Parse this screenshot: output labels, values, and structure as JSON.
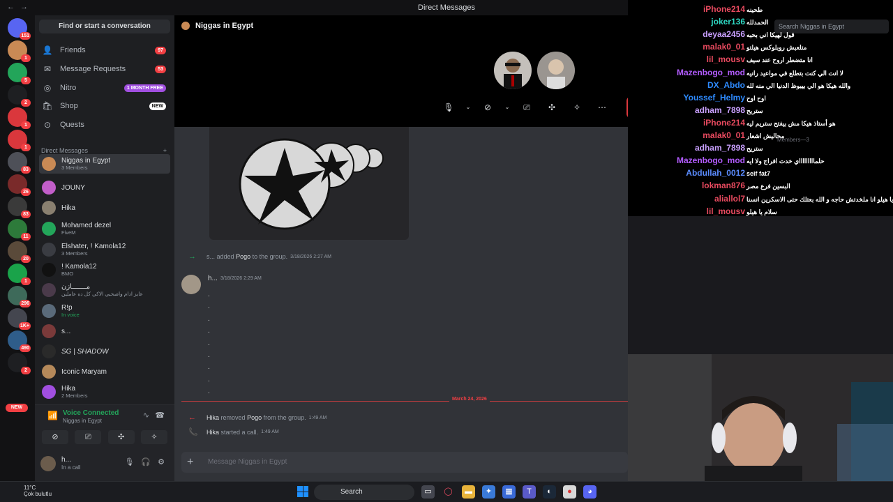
{
  "titlebar": {
    "title": "Direct Messages"
  },
  "dm_column": {
    "find_label": "Find or start a conversation",
    "nav": [
      {
        "label": "Friends",
        "badge": "97"
      },
      {
        "label": "Message Requests",
        "badge": "53"
      },
      {
        "label": "Nitro",
        "badge": "1 MONTH FREE"
      },
      {
        "label": "Shop",
        "badge": "NEW"
      },
      {
        "label": "Quests",
        "badge": ""
      }
    ],
    "dm_header": "Direct Messages",
    "dms": [
      {
        "name": "Niggas in Egypt",
        "sub": "3 Members"
      },
      {
        "name": "JOUNY",
        "sub": ""
      },
      {
        "name": "Hika",
        "sub": ""
      },
      {
        "name": "Mohamed dezel",
        "sub": "FiveM"
      },
      {
        "name": "Elshater, ! Kamola12",
        "sub": "3 Members"
      },
      {
        "name": "! Kamola12",
        "sub": "BMO"
      },
      {
        "name": "مـــــــازن",
        "sub": "عايز ادام واصحبي الاكي كل ده عاملين"
      },
      {
        "name": "R!p",
        "sub": "In voice"
      },
      {
        "name": "s...",
        "sub": ""
      },
      {
        "name": "SG | SHADOW",
        "sub": ""
      },
      {
        "name": "Iconic Maryam",
        "sub": ""
      },
      {
        "name": "Hika",
        "sub": "2 Members"
      }
    ]
  },
  "server_badges": [
    "151",
    "1",
    "5",
    "2",
    "1",
    "1",
    "83",
    "26",
    "83",
    "11",
    "20",
    "1",
    "296",
    "1K+",
    "490",
    "2"
  ],
  "server_new": "NEW",
  "voice": {
    "status": "Voice Connected",
    "channel": "Niggas in Egypt"
  },
  "user": {
    "name": "h...",
    "status": "In a call"
  },
  "channel": {
    "name": "Niggas in Egypt",
    "added_msg": {
      "actor": "s...",
      "verb": "added",
      "target": "Pogo",
      "rest": "to the group.",
      "time": "3/18/2026 2:27 AM"
    },
    "message": {
      "author": "h...",
      "time": "3/18/2026 2:29 AM",
      "lines": [
        ".",
        ".",
        ".",
        ".",
        ".",
        ".",
        ".",
        ".",
        "."
      ]
    },
    "date_divider": "March 24, 2026",
    "removed_msg": {
      "actor": "Hika",
      "verb": "removed",
      "target": "Pogo",
      "rest": "from the group.",
      "time": "1:49 AM"
    },
    "call_msg": {
      "actor": "Hika",
      "rest": "started a call.",
      "time": "1:49 AM"
    },
    "composer_placeholder": "Message Niggas in Egypt"
  },
  "chat_overlay": {
    "search_placeholder": "Search Niggas in Egypt",
    "members_label": "Members—3",
    "messages": [
      {
        "user": "iPhone214",
        "text": "طحينه",
        "color": "#e84a5f"
      },
      {
        "user": "joker136",
        "text": "الحمدلله",
        "color": "#2ed8c3"
      },
      {
        "user": "deyaa2456",
        "text": "قول لهيكا اني بحبه",
        "color": "#c9a0ff"
      },
      {
        "user": "malak0_01",
        "text": "متلعبش روبلوكس هيلتو",
        "color": "#e84a5f"
      },
      {
        "user": "lil_mousv",
        "text": "انا متضطر اروح عند سيف",
        "color": "#e84a5f"
      },
      {
        "user": "Mazenbogo_mod",
        "text": "لا انت الي كنت بتطلع في مواعيد رانيه",
        "color": "#b35cff"
      },
      {
        "user": "DX_Abdo",
        "text": "والله هيكا هو الي بيبوظ الدنيا الي منه لله",
        "color": "#2e8bff"
      },
      {
        "user": "Youssef_Helmy",
        "text": "اوح اوح",
        "color": "#2e8bff"
      },
      {
        "user": "adham_7898",
        "text": "ستريح",
        "color": "#c9a0ff"
      },
      {
        "user": "iPhone214",
        "text": "هو أستاذ هيكا مش بيفتح ستريم ليه",
        "color": "#e84a5f"
      },
      {
        "user": "malak0_01",
        "text": "محاليش اشعار",
        "color": "#e84a5f"
      },
      {
        "user": "adham_7898",
        "text": "ستريح",
        "color": "#c9a0ff"
      },
      {
        "user": "Mazenbogo_mod",
        "text": "حلماااااااااي خدت افراج ولا ايه",
        "color": "#b35cff"
      },
      {
        "user": "Abdullah_0012",
        "text": "seif fat7",
        "color": "#5b8cff"
      },
      {
        "user": "lokman876",
        "text": "البسين فرع مصر",
        "color": "#e84a5f"
      },
      {
        "user": "aliallol7",
        "text": "يا هيلو انا ملخدتش حاجه و الله بعتلك حتى الاسكرين انسنا",
        "color": "#e84a5f"
      },
      {
        "user": "lil_mousv",
        "text": "سلام يا هيلو",
        "color": "#e84a5f"
      }
    ]
  },
  "taskbar": {
    "temp": "11°C",
    "weather": "Çok bulutlu",
    "search_label": "Search"
  }
}
